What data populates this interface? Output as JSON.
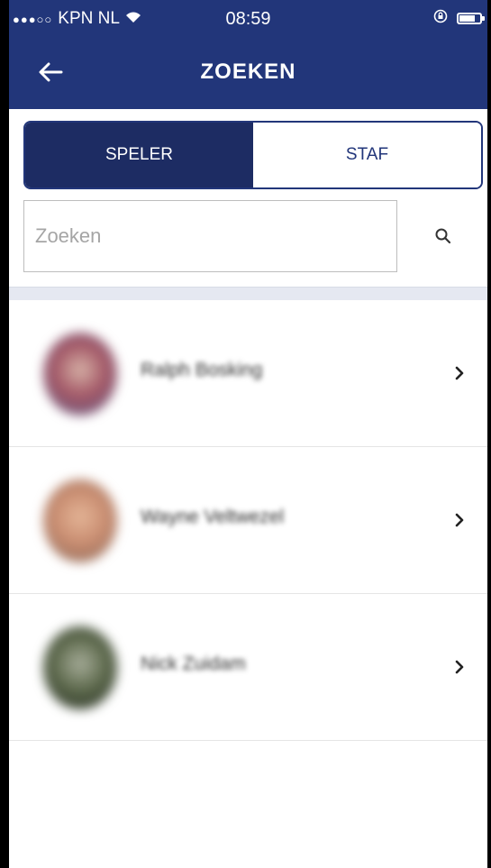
{
  "status_bar": {
    "carrier": "KPN NL",
    "signal_dots": "●●●○○",
    "time": "08:59"
  },
  "header": {
    "title": "ZOEKEN"
  },
  "tabs": [
    {
      "label": "SPELER",
      "active": true
    },
    {
      "label": "STAF",
      "active": false
    }
  ],
  "search": {
    "placeholder": "Zoeken",
    "value": ""
  },
  "players": [
    {
      "name": "Ralph Bosking"
    },
    {
      "name": "Wayne Veltwezel"
    },
    {
      "name": "Nick Zuidam"
    }
  ],
  "colors": {
    "brand": "#22367a",
    "brand_dark": "#1d2c63",
    "divider": "#e5e8f1"
  },
  "icons": [
    "back-arrow-icon",
    "search-icon",
    "chevron-right-icon",
    "wifi-icon",
    "lock-rotation-icon",
    "battery-icon"
  ]
}
